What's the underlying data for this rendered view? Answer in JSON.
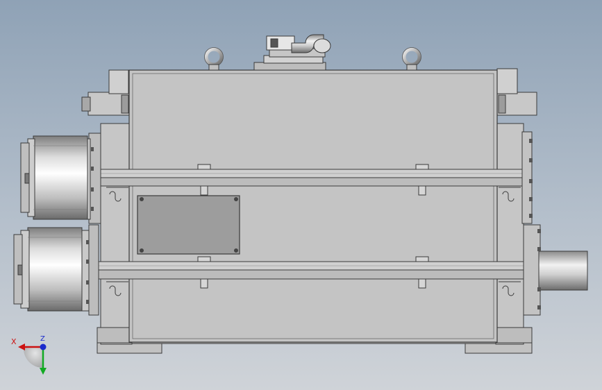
{
  "viewport": {
    "background_top": "#8fa2b6",
    "background_bottom": "#cfd3d8"
  },
  "model": {
    "body_color": "#c4c4c4",
    "edge_color": "#3a3a3a",
    "cover_plate_color": "#9d9d9d"
  },
  "triad": {
    "x_label": "X",
    "z_label": "Z",
    "x_color": "#cc1111",
    "y_color": "#11aa22",
    "z_color": "#1a2acc"
  }
}
